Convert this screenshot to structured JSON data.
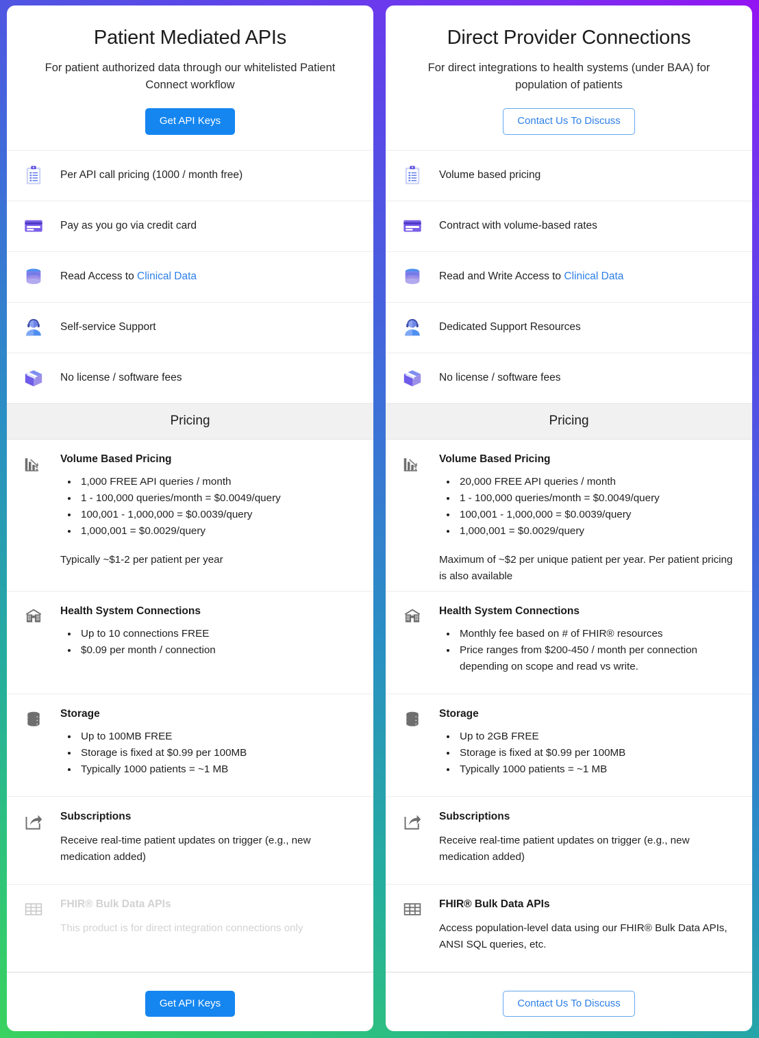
{
  "plans": [
    {
      "id": "patient-mediated",
      "title": "Patient Mediated APIs",
      "subtitle": "For patient authorized data through our whitelisted Patient Connect workflow",
      "cta": {
        "label": "Get API Keys",
        "style": "solid"
      },
      "features": [
        {
          "icon": "clipboard-icon",
          "text": "Per API call pricing (1000 / month free)"
        },
        {
          "icon": "credit-card-icon",
          "text": "Pay as you go via credit card"
        },
        {
          "icon": "database-icon",
          "text_before": "Read Access to ",
          "link": "Clinical Data"
        },
        {
          "icon": "support-agent-icon",
          "text": "Self-service Support"
        },
        {
          "icon": "package-box-icon",
          "text": "No license / software fees"
        }
      ],
      "pricing_header": "Pricing",
      "pricing_blocks": [
        {
          "icon": "bar-chart-down-icon",
          "title": "Volume Based Pricing",
          "bullets": [
            "1,000 FREE API queries / month",
            "1 - 100,000 queries/month = $0.0049/query",
            "100,001 - 1,000,000 = $0.0039/query",
            "1,000,001 = $0.0029/query"
          ],
          "note": "Typically ~$1-2 per patient per year",
          "disabled": false
        },
        {
          "icon": "hospital-icon",
          "title": "Health System Connections",
          "bullets": [
            "Up to 10 connections FREE",
            "$0.09 per month / connection"
          ],
          "note": "",
          "disabled": false
        },
        {
          "icon": "storage-db-icon",
          "title": "Storage",
          "bullets": [
            "Up to 100MB FREE",
            "Storage is fixed at $0.99 per 100MB",
            "Typically 1000 patients = ~1 MB"
          ],
          "note": "",
          "disabled": false
        },
        {
          "icon": "share-arrow-icon",
          "title": "Subscriptions",
          "bullets": [],
          "desc": "Receive real-time patient updates on trigger (e.g., new medication added)",
          "disabled": false
        },
        {
          "icon": "table-grid-icon",
          "title": "FHIR® Bulk Data APIs",
          "bullets": [],
          "desc": "This product is for direct integration connections only",
          "disabled": true
        }
      ],
      "footer_cta": {
        "label": "Get API Keys",
        "style": "solid"
      }
    },
    {
      "id": "direct-provider",
      "title": "Direct Provider Connections",
      "subtitle": "For direct integrations to health systems (under BAA) for population of patients",
      "cta": {
        "label": "Contact Us To Discuss",
        "style": "outline"
      },
      "features": [
        {
          "icon": "clipboard-icon",
          "text": "Volume based pricing"
        },
        {
          "icon": "credit-card-icon",
          "text": "Contract with volume-based rates"
        },
        {
          "icon": "database-icon",
          "text_before": "Read and Write Access to ",
          "link": "Clinical Data"
        },
        {
          "icon": "support-agent-icon",
          "text": "Dedicated Support Resources"
        },
        {
          "icon": "package-box-icon",
          "text": "No license / software fees"
        }
      ],
      "pricing_header": "Pricing",
      "pricing_blocks": [
        {
          "icon": "bar-chart-down-icon",
          "title": "Volume Based Pricing",
          "bullets": [
            "20,000 FREE API queries / month",
            "1 - 100,000 queries/month = $0.0049/query",
            "100,001 - 1,000,000 = $0.0039/query",
            "1,000,001 = $0.0029/query"
          ],
          "note": "Maximum of ~$2 per unique patient per year. Per patient pricing is also available",
          "disabled": false
        },
        {
          "icon": "hospital-icon",
          "title": "Health System Connections",
          "bullets": [
            "Monthly fee based on # of FHIR® resources",
            "Price ranges from $200-450 / month per connection depending on scope and read vs write."
          ],
          "note": "",
          "disabled": false
        },
        {
          "icon": "storage-db-icon",
          "title": "Storage",
          "bullets": [
            "Up to 2GB FREE",
            "Storage is fixed at $0.99 per 100MB",
            "Typically 1000 patients = ~1 MB"
          ],
          "note": "",
          "disabled": false
        },
        {
          "icon": "share-arrow-icon",
          "title": "Subscriptions",
          "bullets": [],
          "desc": "Receive real-time patient updates on trigger (e.g., new medication added)",
          "disabled": false
        },
        {
          "icon": "table-grid-icon",
          "title": "FHIR® Bulk Data APIs",
          "bullets": [],
          "desc": "Access population-level data using our FHIR® Bulk Data APIs, ANSI SQL queries, etc.",
          "disabled": false
        }
      ],
      "footer_cta": {
        "label": "Contact Us To Discuss",
        "style": "outline"
      }
    }
  ],
  "colors": {
    "primary_button": "#1586f0",
    "outline_button_text": "#2d7fe8",
    "link": "#2d7fe8",
    "band_background": "#f1f1f1",
    "gradient_start": "#9413f2",
    "gradient_end": "#3ad25f",
    "icon_violet": "#6f5ce8",
    "icon_blue": "#4f8ff0",
    "icon_grey": "#6e6e6e",
    "disabled_text": "#d2d2d2"
  }
}
